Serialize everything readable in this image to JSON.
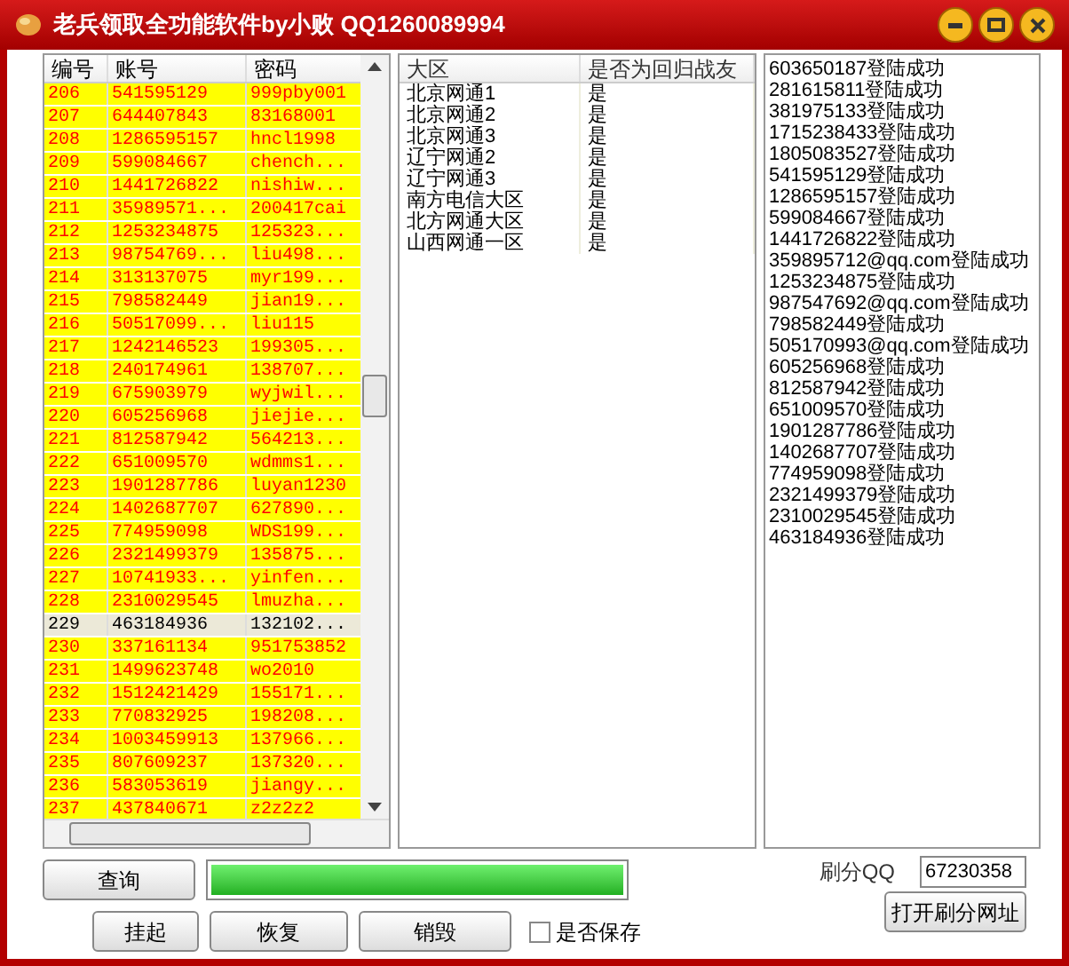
{
  "window": {
    "title": "老兵领取全功能软件by小败 QQ1260089994"
  },
  "accounts": {
    "columns": [
      "编号",
      "账号",
      "密码"
    ],
    "rows": [
      {
        "cells": [
          "206",
          "541595129",
          "999pby001"
        ],
        "selected": false
      },
      {
        "cells": [
          "207",
          "644407843",
          "83168001"
        ],
        "selected": false
      },
      {
        "cells": [
          "208",
          "1286595157",
          "hncl1998"
        ],
        "selected": false
      },
      {
        "cells": [
          "209",
          "599084667",
          "chench..."
        ],
        "selected": false
      },
      {
        "cells": [
          "210",
          "1441726822",
          "nishiw..."
        ],
        "selected": false
      },
      {
        "cells": [
          "211",
          "35989571...",
          "200417cai"
        ],
        "selected": false
      },
      {
        "cells": [
          "212",
          "1253234875",
          "125323..."
        ],
        "selected": false
      },
      {
        "cells": [
          "213",
          "98754769...",
          "liu498..."
        ],
        "selected": false
      },
      {
        "cells": [
          "214",
          "313137075",
          "myr199..."
        ],
        "selected": false
      },
      {
        "cells": [
          "215",
          "798582449",
          "jian19..."
        ],
        "selected": false
      },
      {
        "cells": [
          "216",
          "50517099...",
          "liu115"
        ],
        "selected": false
      },
      {
        "cells": [
          "217",
          "1242146523",
          "199305..."
        ],
        "selected": false
      },
      {
        "cells": [
          "218",
          "240174961",
          "138707..."
        ],
        "selected": false
      },
      {
        "cells": [
          "219",
          "675903979",
          "wyjwil..."
        ],
        "selected": false
      },
      {
        "cells": [
          "220",
          "605256968",
          "jiejie..."
        ],
        "selected": false
      },
      {
        "cells": [
          "221",
          "812587942",
          "564213..."
        ],
        "selected": false
      },
      {
        "cells": [
          "222",
          "651009570",
          "wdmms1..."
        ],
        "selected": false
      },
      {
        "cells": [
          "223",
          "1901287786",
          "luyan1230"
        ],
        "selected": false
      },
      {
        "cells": [
          "224",
          "1402687707",
          "627890..."
        ],
        "selected": false
      },
      {
        "cells": [
          "225",
          "774959098",
          "WDS199..."
        ],
        "selected": false
      },
      {
        "cells": [
          "226",
          "2321499379",
          "135875..."
        ],
        "selected": false
      },
      {
        "cells": [
          "227",
          "10741933...",
          "yinfen..."
        ],
        "selected": false
      },
      {
        "cells": [
          "228",
          "2310029545",
          "lmuzha..."
        ],
        "selected": false
      },
      {
        "cells": [
          "229",
          "463184936",
          "132102..."
        ],
        "selected": true
      },
      {
        "cells": [
          "230",
          "337161134",
          "951753852"
        ],
        "selected": false
      },
      {
        "cells": [
          "231",
          "1499623748",
          "wo2010"
        ],
        "selected": false
      },
      {
        "cells": [
          "232",
          "1512421429",
          "155171..."
        ],
        "selected": false
      },
      {
        "cells": [
          "233",
          "770832925",
          "198208..."
        ],
        "selected": false
      },
      {
        "cells": [
          "234",
          "1003459913",
          "137966..."
        ],
        "selected": false
      },
      {
        "cells": [
          "235",
          "807609237",
          "137320..."
        ],
        "selected": false
      },
      {
        "cells": [
          "236",
          "583053619",
          "jiangy..."
        ],
        "selected": false
      },
      {
        "cells": [
          "237",
          "437840671",
          "z2z2z2"
        ],
        "selected": false
      }
    ]
  },
  "regions": {
    "columns": [
      "大区",
      "是否为回归战友"
    ],
    "rows": [
      [
        "北京网通1",
        "是"
      ],
      [
        "北京网通2",
        "是"
      ],
      [
        "北京网通3",
        "是"
      ],
      [
        "辽宁网通2",
        "是"
      ],
      [
        "辽宁网通3",
        "是"
      ],
      [
        "南方电信大区",
        "是"
      ],
      [
        "北方网通大区",
        "是"
      ],
      [
        "山西网通一区",
        "是"
      ]
    ]
  },
  "log": [
    "603650187登陆成功",
    "281615811登陆成功",
    "381975133登陆成功",
    "1715238433登陆成功",
    "1805083527登陆成功",
    "541595129登陆成功",
    "1286595157登陆成功",
    "599084667登陆成功",
    "1441726822登陆成功",
    "359895712@qq.com登陆成功",
    "1253234875登陆成功",
    "987547692@qq.com登陆成功",
    "798582449登陆成功",
    "505170993@qq.com登陆成功",
    "605256968登陆成功",
    "812587942登陆成功",
    "651009570登陆成功",
    "1901287786登陆成功",
    "1402687707登陆成功",
    "774959098登陆成功",
    "2321499379登陆成功",
    "2310029545登陆成功",
    "463184936登陆成功"
  ],
  "query_button": "查询",
  "progress": {
    "level": 1
  },
  "brush_qq": {
    "label": "刷分QQ",
    "value": "67230358"
  },
  "open_url_button": "打开刷分网址",
  "buttons": [
    "挂起",
    "恢复",
    "销毁"
  ],
  "save": {
    "label": "是否保存",
    "checked": false
  }
}
